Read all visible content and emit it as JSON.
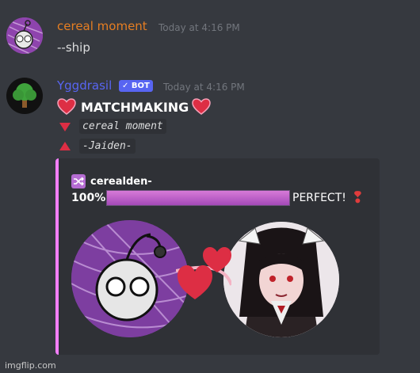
{
  "messages": [
    {
      "username": "cereal moment",
      "username_color": "#e67e22",
      "timestamp": "Today at 4:16 PM",
      "content": "--ship",
      "avatar_icon": "alien-doodle-avatar"
    },
    {
      "username": "Yggdrasil",
      "username_color": "#5865f2",
      "timestamp": "Today at 4:16 PM",
      "bot_tag": "✓ BOT",
      "avatar_icon": "tree-avatar",
      "title": "MATCHMAKING",
      "lines": [
        {
          "icon": "down-triangle-icon",
          "text": "cereal moment"
        },
        {
          "icon": "up-triangle-icon",
          "text": "-Jaiden-"
        }
      ],
      "embed": {
        "accent_color": "#f47fff",
        "author_icon": "shuffle-icon",
        "author_name": "cerealden-",
        "percent_label": "100%",
        "match_fraction": 1.0,
        "result_label": "PERFECT!",
        "result_icon": "exclamation-icon"
      }
    }
  ],
  "watermark": "imgflip.com"
}
